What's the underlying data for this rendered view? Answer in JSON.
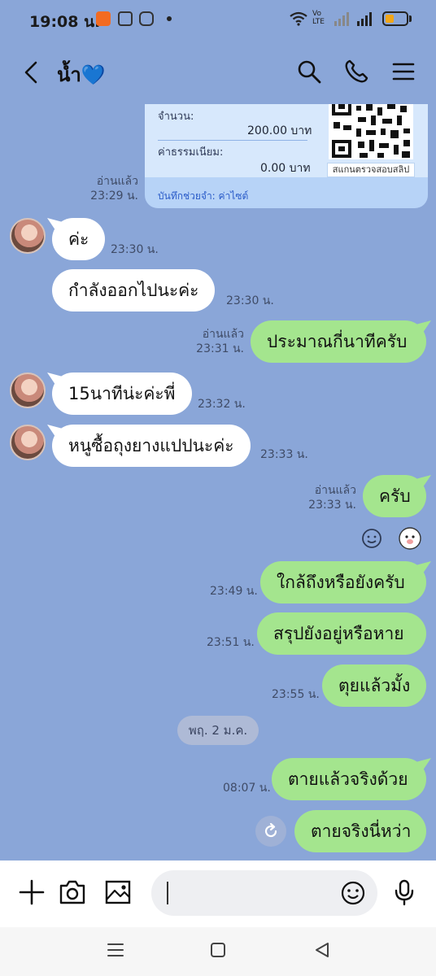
{
  "status_bar": {
    "time": "19:08 น.",
    "network": "Vo LTE",
    "colors": {
      "battery": "#f1a619"
    }
  },
  "header": {
    "title": "น้ำ💙",
    "icons": [
      "back-icon",
      "search-icon",
      "phone-icon",
      "menu-icon"
    ]
  },
  "slip": {
    "amount_label": "จำนวน:",
    "amount_value": "200.00 บาท",
    "fee_label": "ค่าธรรมเนียม:",
    "fee_value": "0.00 บาท",
    "qr_caption": "สแกนตรวจสอบสลิป",
    "memo": "บันทึกช่วยจำ: ค่าไซต์"
  },
  "messages": [
    {
      "id": "slip_read",
      "direction": "out",
      "read": "อ่านแล้ว",
      "time": "23:29 น."
    },
    {
      "id": "m1",
      "direction": "in",
      "text": "ค่ะ",
      "time": "23:30 น."
    },
    {
      "id": "m2",
      "direction": "in",
      "text": "กำลังออกไปนะค่ะ",
      "time": "23:30 น."
    },
    {
      "id": "m3",
      "direction": "out",
      "text": "ประมาณกี่นาทีครับ",
      "read": "อ่านแล้ว",
      "time": "23:31 น."
    },
    {
      "id": "m4",
      "direction": "in",
      "text": "15นาทีน่ะค่ะพี่",
      "time": "23:32 น."
    },
    {
      "id": "m5",
      "direction": "in",
      "text": "หนูซื้อถุงยางแปปนะค่ะ",
      "time": "23:33 น."
    },
    {
      "id": "m6",
      "direction": "out",
      "text": "ครับ",
      "read": "อ่านแล้ว",
      "time": "23:33 น."
    },
    {
      "id": "m7",
      "direction": "out",
      "text": "ใกล้ถึงหรือยังครับ",
      "time": "23:49 น."
    },
    {
      "id": "m8",
      "direction": "out",
      "text": "สรุปยังอยู่หรือหาย",
      "time": "23:51 น."
    },
    {
      "id": "m9",
      "direction": "out",
      "text": "ตุยแล้วมั้ง",
      "time": "23:55 น."
    },
    {
      "id": "m10",
      "direction": "out",
      "text": "ตายแล้วจริงด้วย",
      "time": "08:07 น."
    },
    {
      "id": "m11",
      "direction": "out",
      "text": "ตายจริงนี่หว่า",
      "status": "unsent"
    }
  ],
  "date_separator": "พฤ. 2 ม.ค.",
  "input": {
    "placeholder": "",
    "value": ""
  },
  "colors": {
    "chat_background": "#8aa6d8",
    "outgoing_bubble": "#a4e58e",
    "incoming_bubble": "#ffffff"
  }
}
